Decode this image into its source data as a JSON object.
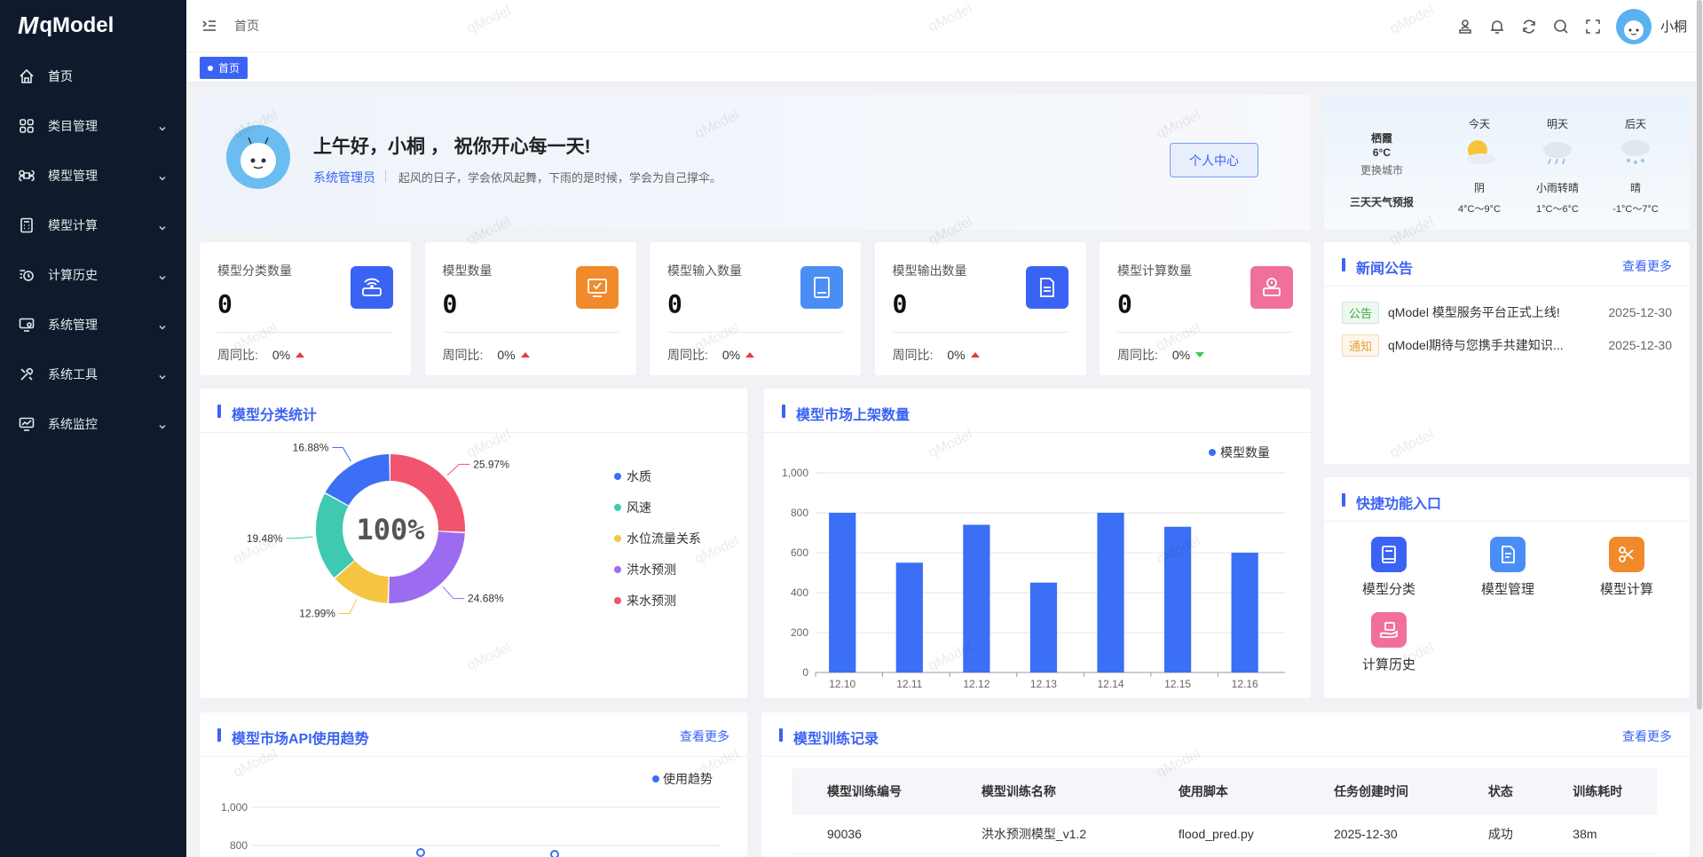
{
  "app": {
    "logo_text": "qModel",
    "logo_mark": "M"
  },
  "sidebar": {
    "items": [
      {
        "label": "首页",
        "icon": "home-icon"
      },
      {
        "label": "类目管理",
        "icon": "grid-icon"
      },
      {
        "label": "模型管理",
        "icon": "command-icon"
      },
      {
        "label": "模型计算",
        "icon": "calculator-icon"
      },
      {
        "label": "计算历史",
        "icon": "history-icon"
      },
      {
        "label": "系统管理",
        "icon": "monitor-settings-icon"
      },
      {
        "label": "系统工具",
        "icon": "tools-icon"
      },
      {
        "label": "系统监控",
        "icon": "monitor-chart-icon"
      }
    ]
  },
  "header": {
    "breadcrumb": "首页",
    "username": "小桐",
    "tag": "首页"
  },
  "welcome": {
    "greeting": "上午好，小桐 ， 祝你开心每一天!",
    "role": "系统管理员",
    "motto": "起风的日子，学会依风起舞，下雨的是时候，学会为自己撑伞。",
    "button": "个人中心"
  },
  "weather": {
    "city": "栖霞",
    "temp": "6°C",
    "change_city": "更换城市",
    "forecast_title": "三天天气预报",
    "days": [
      {
        "label": "今天",
        "cond": "阴",
        "range": "4°C～9°C"
      },
      {
        "label": "明天",
        "cond": "小雨转晴",
        "range": "1°C～6°C"
      },
      {
        "label": "后天",
        "cond": "晴",
        "range": "-1°C～7°C"
      }
    ]
  },
  "stats": [
    {
      "title": "模型分类数量",
      "value": "0",
      "wow_label": "周同比:",
      "wow": "0%",
      "trend": "up",
      "color": "#3b63f3"
    },
    {
      "title": "模型数量",
      "value": "0",
      "wow_label": "周同比:",
      "wow": "0%",
      "trend": "up",
      "color": "#f08a2c"
    },
    {
      "title": "模型输入数量",
      "value": "0",
      "wow_label": "周同比:",
      "wow": "0%",
      "trend": "up",
      "color": "#4a8ef5"
    },
    {
      "title": "模型输出数量",
      "value": "0",
      "wow_label": "周同比:",
      "wow": "0%",
      "trend": "up",
      "color": "#3b63f3"
    },
    {
      "title": "模型计算数量",
      "value": "0",
      "wow_label": "周同比:",
      "wow": "0%",
      "trend": "down",
      "color": "#f0709a"
    }
  ],
  "news": {
    "title": "新闻公告",
    "more": "查看更多",
    "items": [
      {
        "badge": "公告",
        "text": "qModel 模型服务平台正式上线!",
        "date": "2025-12-30"
      },
      {
        "badge": "通知",
        "text": "qModel期待与您携手共建知识...",
        "date": "2025-12-30"
      }
    ]
  },
  "quick": {
    "title": "快捷功能入口",
    "items": [
      {
        "label": "模型分类",
        "color": "#3b63f3"
      },
      {
        "label": "模型管理",
        "color": "#4a8ef5"
      },
      {
        "label": "模型计算",
        "color": "#f08a2c"
      },
      {
        "label": "计算历史",
        "color": "#f0709a"
      }
    ]
  },
  "pie_section": {
    "title": "模型分类统计",
    "center": "100%"
  },
  "bar_section": {
    "title": "模型市场上架数量"
  },
  "api_section": {
    "title": "模型市场API使用趋势",
    "more": "查看更多"
  },
  "train_section": {
    "title": "模型训练记录",
    "more": "查看更多",
    "columns": [
      "模型训练编号",
      "模型训练名称",
      "使用脚本",
      "任务创建时间",
      "状态",
      "训练耗时"
    ],
    "rows": [
      [
        "90036",
        "洪水预测模型_v1.2",
        "flood_pred.py",
        "2025-12-30",
        "成功",
        "38m"
      ]
    ]
  },
  "watermark": "qModel",
  "chart_data": [
    {
      "type": "pie",
      "categories": [
        "水质",
        "风速",
        "水位流量关系",
        "洪水预测",
        "来水预测"
      ],
      "values": [
        16.88,
        19.48,
        12.99,
        24.68,
        25.97
      ],
      "labels": [
        "16.88%",
        "19.48%",
        "12.99%",
        "24.68%",
        "25.97%"
      ],
      "colors": [
        "#3b6ff5",
        "#3ec9b0",
        "#f5c542",
        "#9b6cf0",
        "#f0546e"
      ],
      "legend": "right"
    },
    {
      "type": "bar",
      "categories": [
        "12.10",
        "12.11",
        "12.12",
        "12.13",
        "12.14",
        "12.15",
        "12.16"
      ],
      "series": [
        {
          "name": "模型数量",
          "values": [
            800,
            550,
            740,
            450,
            800,
            730,
            600
          ]
        }
      ],
      "ylim": [
        0,
        1000
      ],
      "yticks": [
        0,
        200,
        400,
        600,
        800,
        "1,000"
      ],
      "color": "#3b6ff5",
      "legend": "top-right"
    },
    {
      "type": "line",
      "series": [
        {
          "name": "使用趋势"
        }
      ],
      "yticks_visible": [
        "800",
        "1,000"
      ],
      "legend": "top-right"
    }
  ]
}
